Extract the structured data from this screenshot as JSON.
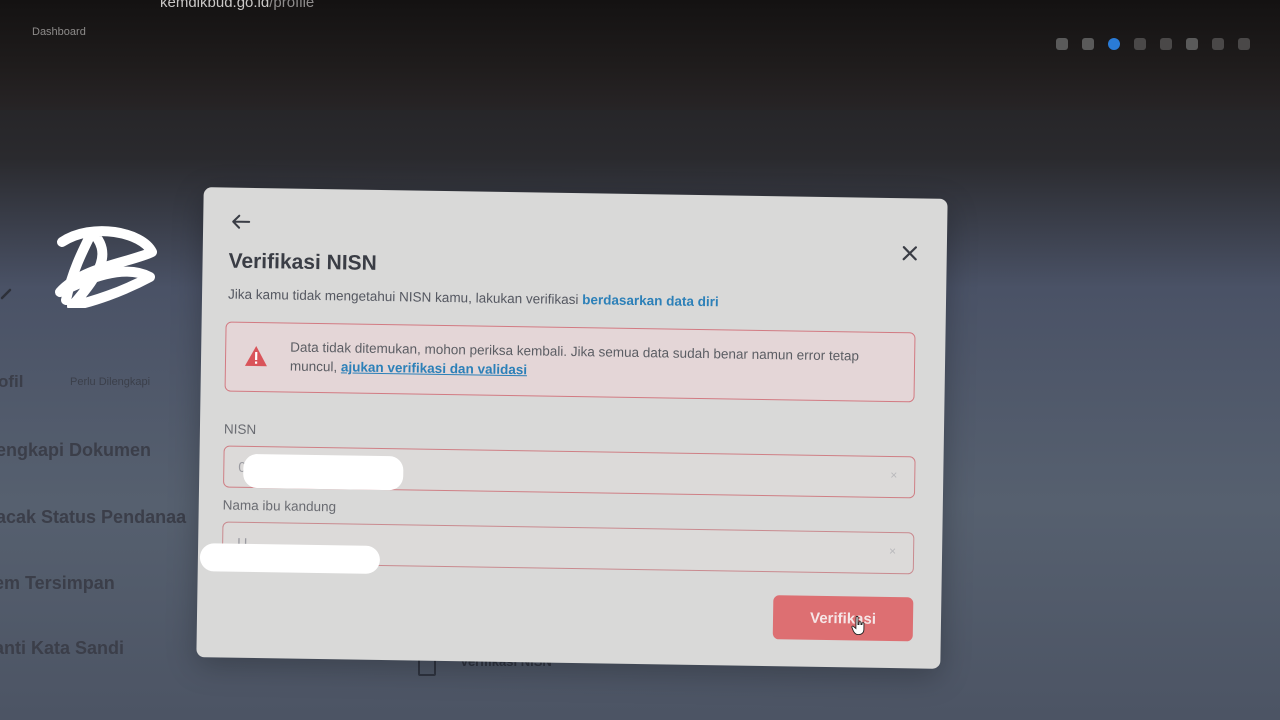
{
  "browser": {
    "url_host": "kemdikbud.go.id",
    "url_path": "/profile",
    "tab_title": "Dashboard"
  },
  "sidebar": {
    "status_label": "ofil",
    "status_badge": "Perlu Dilengkapi",
    "items": [
      {
        "label": "engkapi Dokumen"
      },
      {
        "label": "acak Status Pendanaa"
      },
      {
        "label": "em Tersimpan"
      },
      {
        "label": "anti Kata Sandi"
      }
    ]
  },
  "background": {
    "bottom_item_label": "Verifikasi NISN"
  },
  "modal": {
    "title": "Verifikasi NISN",
    "subtitle_prefix": "Jika kamu tidak mengetahui NISN kamu, lakukan verifikasi ",
    "subtitle_link": "berdasarkan data diri",
    "alert": {
      "text_prefix": "Data tidak ditemukan, mohon periksa kembali. Jika semua data sudah benar namun error tetap muncul, ",
      "link": "ajukan verifikasi dan validasi"
    },
    "fields": {
      "nisn": {
        "label": "NISN",
        "value": "0"
      },
      "mother_name": {
        "label": "Nama ibu kandung",
        "value": "U"
      }
    },
    "submit_label": "Verifikasi"
  },
  "colors": {
    "accent_link": "#2c80b8",
    "error_border": "#d27a82",
    "button": "#dd6f72",
    "alert_icon": "#d9545a"
  }
}
